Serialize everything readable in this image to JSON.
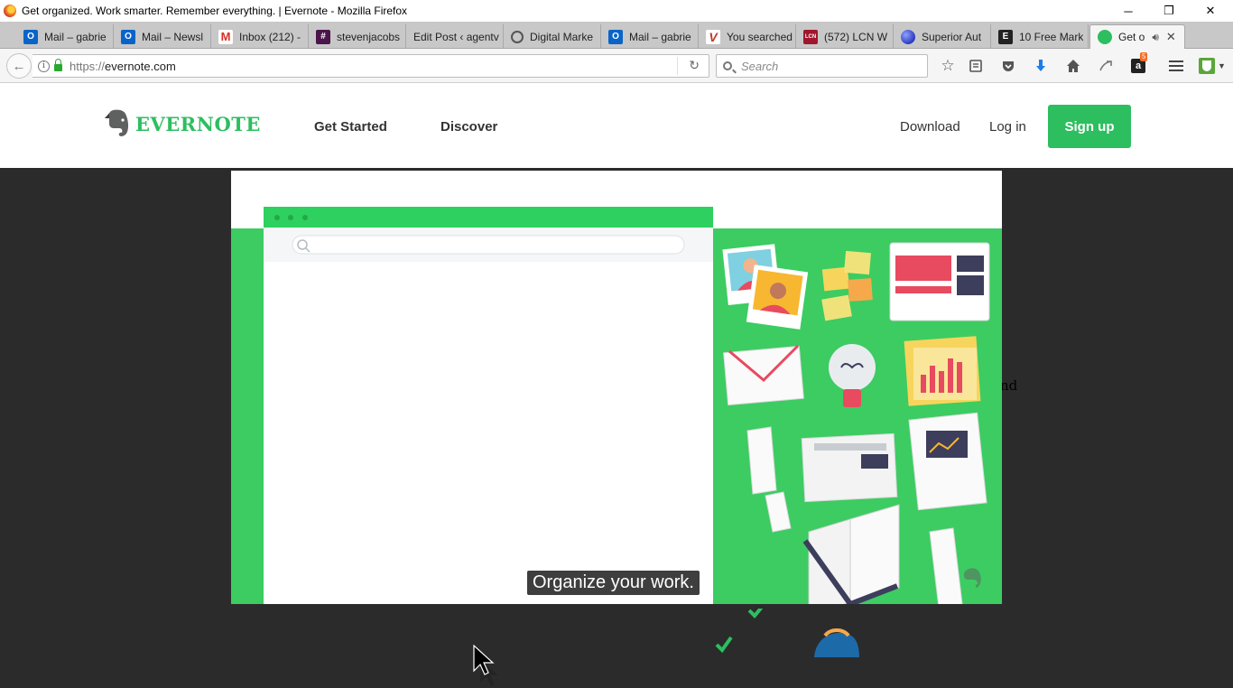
{
  "window": {
    "title": "Get organized. Work smarter. Remember everything. | Evernote - Mozilla Firefox",
    "minimize": "─",
    "restore": "❐",
    "close": "✕"
  },
  "tabs": [
    {
      "label": "Mail – gabrie",
      "icon": "outlook-icon",
      "color": "#0a64c8"
    },
    {
      "label": "Mail – Newsl",
      "icon": "outlook-icon",
      "color": "#0a64c8"
    },
    {
      "label": "Inbox (212) -",
      "icon": "gmail-icon",
      "color": "#d93025"
    },
    {
      "label": "stevenjacobs",
      "icon": "slack-hash-icon",
      "color": "#4a154b"
    },
    {
      "label": "Edit Post ‹ agentv",
      "icon": "",
      "color": ""
    },
    {
      "label": "Digital Marke",
      "icon": "globe-swirl-icon",
      "color": "#555555"
    },
    {
      "label": "Mail – gabrie",
      "icon": "outlook-icon",
      "color": "#0a64c8"
    },
    {
      "label": "You searched",
      "icon": "v-logo-icon",
      "color": "#c0392b"
    },
    {
      "label": "(572) LCN W",
      "icon": "lcn-icon",
      "color": "#a0162c"
    },
    {
      "label": "Superior Aut",
      "icon": "sphere-icon",
      "color": "#2a3bbf"
    },
    {
      "label": "10 Free Mark",
      "icon": "e-logo-icon",
      "color": "#222222"
    },
    {
      "label": "Get o",
      "icon": "evernote-icon",
      "color": "#2dbe60",
      "active": true
    }
  ],
  "newtab": "+",
  "navbar": {
    "back": "←",
    "url_scheme": "https://",
    "url_host": "evernote.com",
    "reload": "↻",
    "search_placeholder": "Search",
    "amazon_badge": "5"
  },
  "site": {
    "brand": "EVERNOTE",
    "nav": {
      "get_started": "Get Started",
      "discover": "Discover"
    },
    "download": "Download",
    "login": "Log in",
    "signup": "Sign up",
    "behind_fragment": "nd",
    "video_caption": "Organize your work.",
    "brand_color": "#2dbe60"
  }
}
